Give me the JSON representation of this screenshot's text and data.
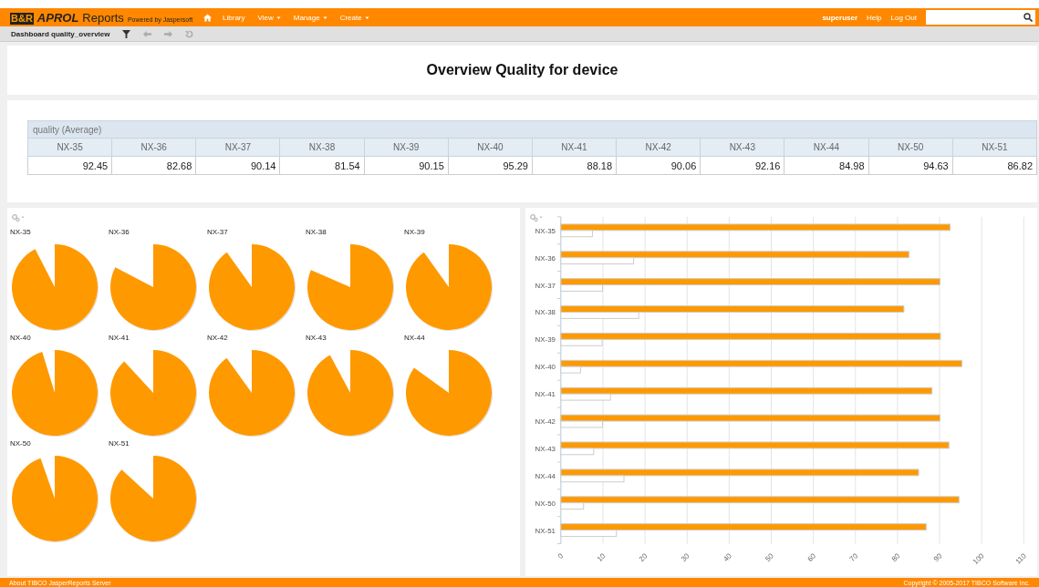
{
  "header": {
    "logo_mark": "B&R",
    "logo_name": "APROL",
    "product": "Reports",
    "powered_by": "Powered by Jaspersoft",
    "nav": [
      {
        "label": "Library",
        "dropdown": false
      },
      {
        "label": "View",
        "dropdown": true
      },
      {
        "label": "Manage",
        "dropdown": true
      },
      {
        "label": "Create",
        "dropdown": true
      }
    ],
    "user": "superuser",
    "links": [
      "Help",
      "Log Out"
    ]
  },
  "toolbar": {
    "title": "Dashboard quality_overview"
  },
  "report_title": "Overview Quality for device",
  "table": {
    "group_header": "quality (Average)",
    "columns": [
      "NX-35",
      "NX-36",
      "NX-37",
      "NX-38",
      "NX-39",
      "NX-40",
      "NX-41",
      "NX-42",
      "NX-43",
      "NX-44",
      "NX-50",
      "NX-51"
    ],
    "values": [
      "92.45",
      "82.68",
      "90.14",
      "81.54",
      "90.15",
      "95.29",
      "88.18",
      "90.06",
      "92.16",
      "84.98",
      "94.63",
      "86.82"
    ]
  },
  "pies": [
    {
      "label": "NX-35"
    },
    {
      "label": "NX-36"
    },
    {
      "label": "NX-37"
    },
    {
      "label": "NX-38"
    },
    {
      "label": "NX-39"
    },
    {
      "label": "NX-40"
    },
    {
      "label": "NX-41"
    },
    {
      "label": "NX-42"
    },
    {
      "label": "NX-43"
    },
    {
      "label": "NX-44"
    },
    {
      "label": "NX-50"
    },
    {
      "label": "NX-51"
    }
  ],
  "bar_chart": {
    "chart_data": {
      "type": "bar",
      "orientation": "horizontal",
      "stacked": false,
      "categories": [
        "NX-35",
        "NX-36",
        "NX-37",
        "NX-38",
        "NX-39",
        "NX-40",
        "NX-41",
        "NX-42",
        "NX-43",
        "NX-44",
        "NX-50",
        "NX-51"
      ],
      "series": [
        {
          "color": "#ff9900",
          "values": [
            92.5,
            82.7,
            90.1,
            81.5,
            90.2,
            95.3,
            88.2,
            90.1,
            92.2,
            85.0,
            94.6,
            86.8
          ]
        },
        {
          "color": "#ffffff",
          "values": [
            7.5,
            17.3,
            9.9,
            18.5,
            9.8,
            4.7,
            11.8,
            9.9,
            7.8,
            15.0,
            5.4,
            13.2
          ]
        }
      ],
      "xlim": [
        0,
        110
      ],
      "grid": true,
      "xticks": [
        0,
        10,
        20,
        30,
        40,
        50,
        60,
        70,
        80,
        90,
        100,
        110
      ]
    }
  },
  "footer": {
    "left": "About TIBCO JasperReports Server",
    "right": "Copyright © 2005-2017 TIBCO Software Inc."
  }
}
